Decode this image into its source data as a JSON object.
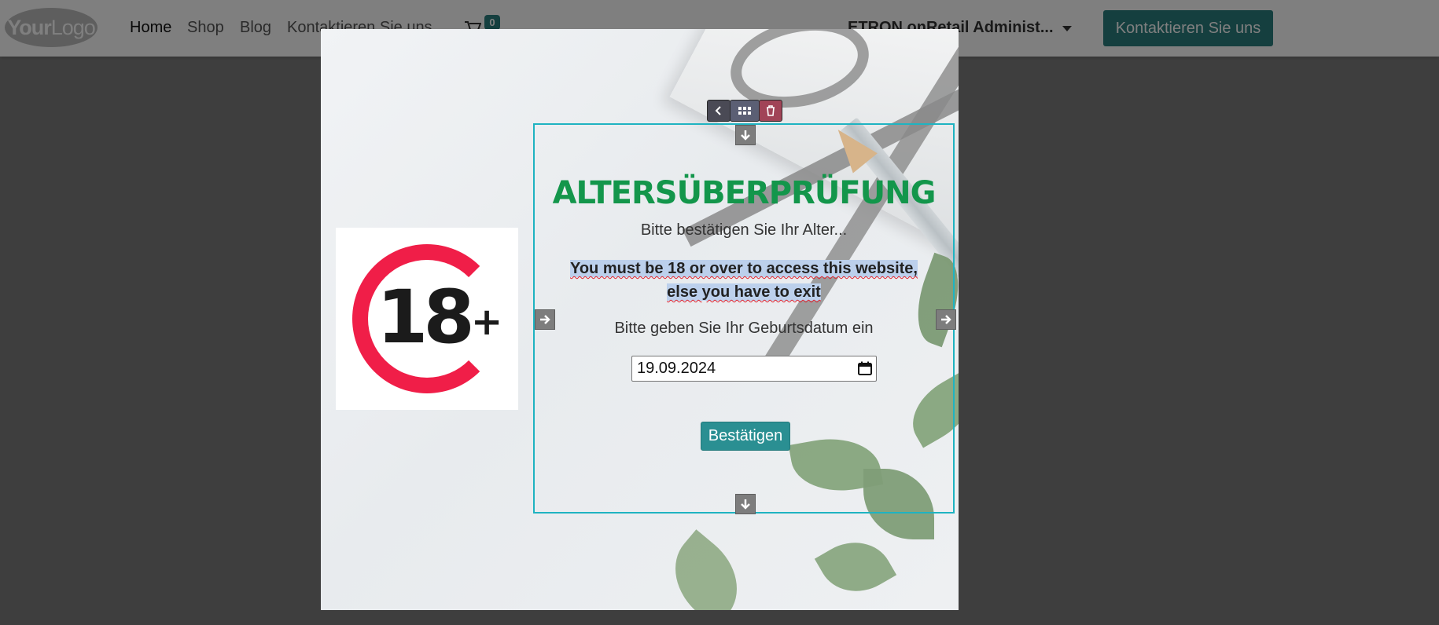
{
  "header": {
    "logo_text_bold": "Your",
    "logo_text": "Logo",
    "nav": [
      {
        "label": "Home",
        "active": true
      },
      {
        "label": "Shop",
        "active": false
      },
      {
        "label": "Blog",
        "active": false
      },
      {
        "label": "Kontaktieren Sie uns",
        "active": false
      }
    ],
    "cart_count": "0",
    "admin_label": "ETRON onRetail Administ...",
    "cta_label": "Kontaktieren Sie uns"
  },
  "modal": {
    "badge_text": "18",
    "badge_plus": "+",
    "title": "ALTERSÜBERPRÜFUNG",
    "subtitle": "Bitte bestätigen Sie Ihr Alter...",
    "warning_line1": "You must be 18 or over to access this website,",
    "warning_line2": "else you have to exit",
    "dob_label": "Bitte geben Sie Ihr Geburtsdatum ein",
    "dob_value": "19.09.2024",
    "submit_label": "Bestätigen"
  },
  "colors": {
    "accent": "#2a7f7f",
    "title": "#13964b",
    "selection": "#1fb3c1",
    "badge_ring": "#f01e48",
    "delete": "#a14457"
  },
  "icons": [
    "cart-icon",
    "chevron-down-icon",
    "chevron-left-icon",
    "grid-icon",
    "trash-icon",
    "arrow-down-icon",
    "arrow-right-icon",
    "calendar-icon"
  ]
}
